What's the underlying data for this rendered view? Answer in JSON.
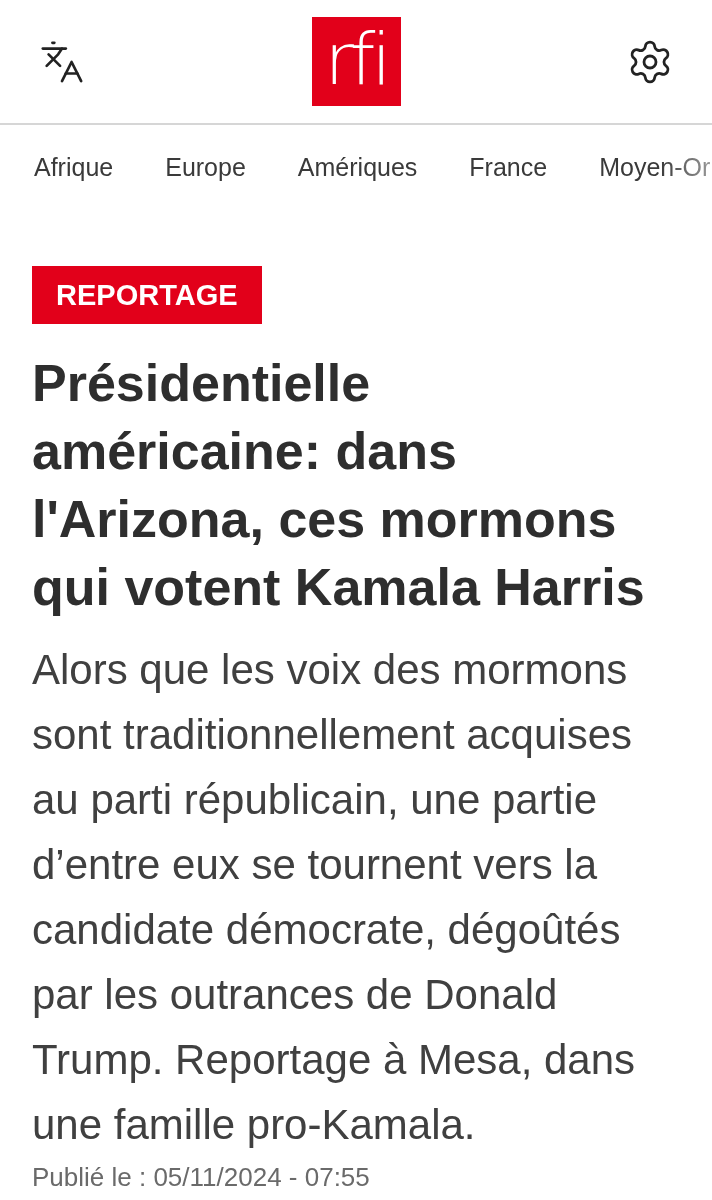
{
  "header": {
    "logo": "rfi"
  },
  "nav": {
    "items": [
      {
        "label": "Afrique",
        "selected": false
      },
      {
        "label": "Europe",
        "selected": false
      },
      {
        "label": "Amériques",
        "selected": false
      },
      {
        "label": "France",
        "selected": false
      },
      {
        "label": "Moyen-Or",
        "selected": false
      }
    ]
  },
  "article": {
    "tag": "REPORTAGE",
    "title": "Présidentielle américaine: dans l'Arizona, ces mormons qui votent Kamala Harris",
    "lead": "Alors que les voix des mormons sont traditionnellement acquises au parti républicain, une partie d’entre eux se tournent vers la candidate démocrate, dégoûtés par les outrances de Donald Trump. Reportage à Mesa, dans une famille pro-Kamala.",
    "published": "Publié le : 05/11/2024 - 07:55"
  }
}
